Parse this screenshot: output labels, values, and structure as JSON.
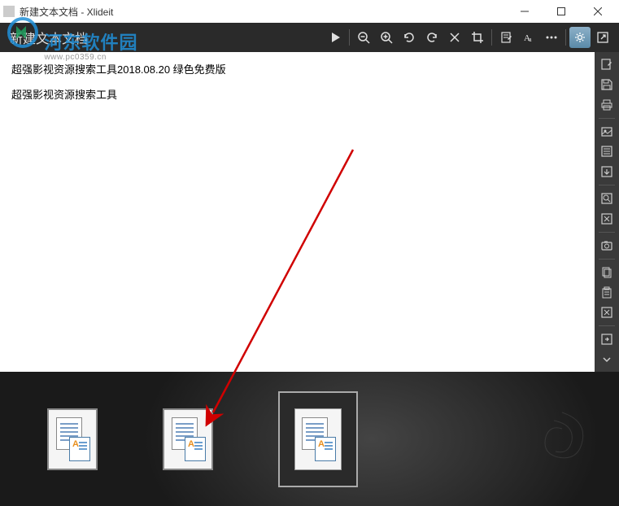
{
  "window": {
    "title": "新建文本文档 - Xlideit"
  },
  "topToolbar": {
    "leftTitle": "新建文本文档"
  },
  "content": {
    "line1": "超强影视资源搜索工具2018.08.20 绿色免费版",
    "line2": "超强影视资源搜索工具"
  },
  "watermark": {
    "main": "河东软件园",
    "sub": "www.pc0359.cn"
  },
  "icons": {
    "play": "play-icon",
    "zoomOut": "zoom-out-icon",
    "zoomIn": "zoom-in-icon",
    "rotateCcw": "rotate-ccw-icon",
    "rotateCw": "rotate-cw-icon",
    "close": "x-icon",
    "crop": "crop-icon",
    "edit": "edit-icon",
    "text": "text-icon",
    "more": "more-icon",
    "settings": "settings-icon",
    "external": "external-icon"
  }
}
